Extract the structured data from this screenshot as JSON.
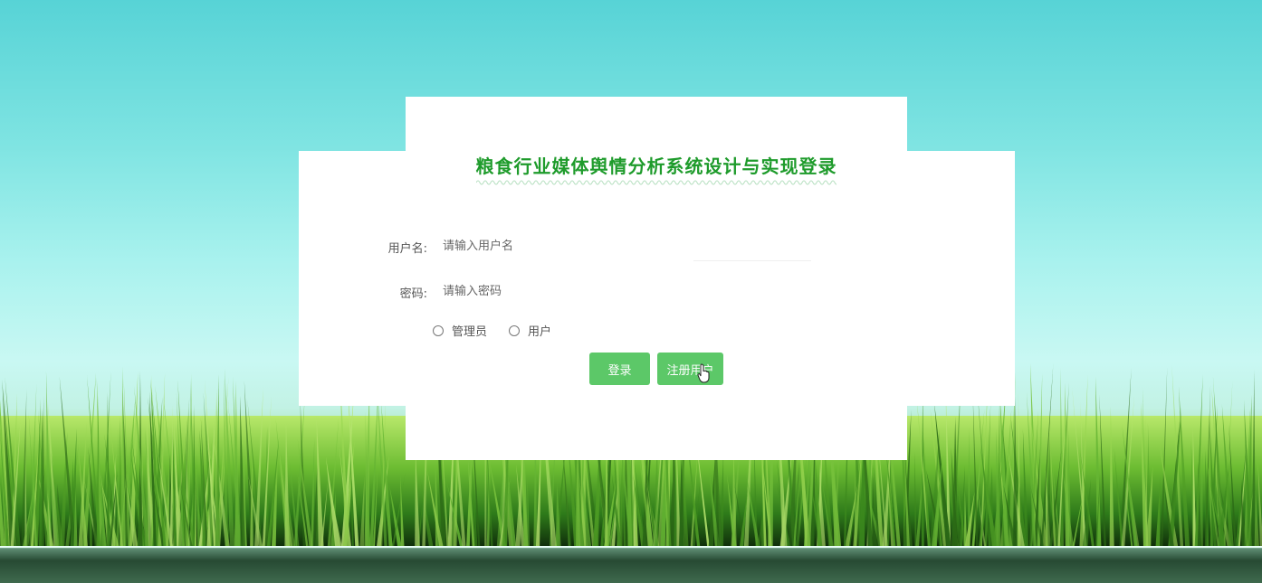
{
  "login": {
    "title": "粮食行业媒体舆情分析系统设计与实现登录",
    "username_label": "用户名:",
    "username_placeholder": "请输入用户名",
    "username_value": "",
    "password_label": "密码:",
    "password_placeholder": "请输入密码",
    "password_value": "",
    "roles": [
      {
        "label": "管理员",
        "selected": false
      },
      {
        "label": "用户",
        "selected": false
      }
    ],
    "login_button": "登录",
    "register_button": "注册用户"
  },
  "colors": {
    "title": "#1e9b2b",
    "button": "#5cc868",
    "panel": "#ffffff"
  },
  "icons": {
    "cursor": "hand-pointer-icon"
  }
}
